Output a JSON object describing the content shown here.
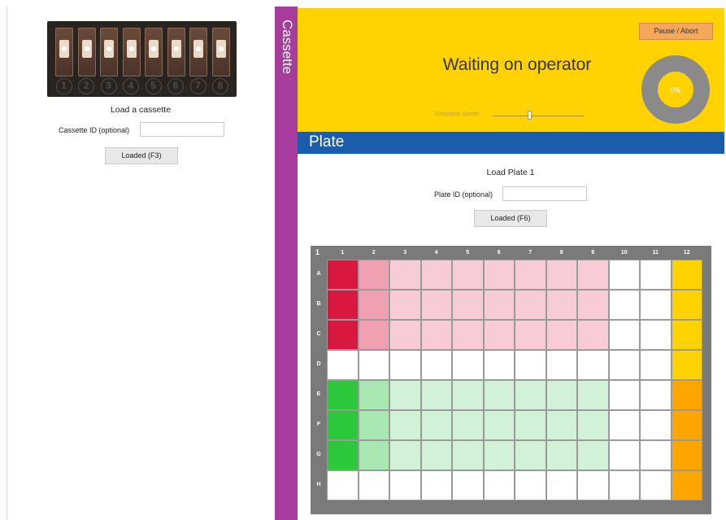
{
  "cassette_panel": {
    "slot_numbers": [
      "1",
      "2",
      "3",
      "4",
      "5",
      "6",
      "7",
      "8"
    ],
    "title": "Load a cassette",
    "cassette_id_label": "Cassette ID (optional)",
    "cassette_id_value": "",
    "loaded_button": "Loaded  (F3)"
  },
  "cassette_strip": {
    "label": "Cassette"
  },
  "status": {
    "message": "Waiting on operator",
    "pause_button": "Pause / Abort",
    "simulation_speed_label": "Simulation Speed",
    "simulation_speed_level": 0.4,
    "progress_percent": 0,
    "progress_text": "0%"
  },
  "plate_panel": {
    "title": "Plate",
    "load_title": "Load Plate 1",
    "plate_id_label": "Plate ID (optional)",
    "plate_id_value": "",
    "loaded_button": "Loaded  (F6)"
  },
  "plate_grid": {
    "corner_label": "1",
    "columns": [
      "1",
      "2",
      "3",
      "4",
      "5",
      "6",
      "7",
      "8",
      "9",
      "10",
      "11",
      "12"
    ],
    "rows": [
      "A",
      "B",
      "C",
      "D",
      "E",
      "F",
      "G",
      "H"
    ],
    "row_colors": [
      [
        "#d9183f",
        "#f0a0b2",
        "#f7ccd6",
        "#f7ccd6",
        "#f7ccd6",
        "#f7ccd6",
        "#f7ccd6",
        "#f7ccd6",
        "#f7ccd6",
        "#ffffff",
        "#ffffff",
        "#ffd200"
      ],
      [
        "#d9183f",
        "#f0a0b2",
        "#f7ccd6",
        "#f7ccd6",
        "#f7ccd6",
        "#f7ccd6",
        "#f7ccd6",
        "#f7ccd6",
        "#f7ccd6",
        "#ffffff",
        "#ffffff",
        "#ffd200"
      ],
      [
        "#d9183f",
        "#f0a0b2",
        "#f7ccd6",
        "#f7ccd6",
        "#f7ccd6",
        "#f7ccd6",
        "#f7ccd6",
        "#f7ccd6",
        "#f7ccd6",
        "#ffffff",
        "#ffffff",
        "#ffd200"
      ],
      [
        "#ffffff",
        "#ffffff",
        "#ffffff",
        "#ffffff",
        "#ffffff",
        "#ffffff",
        "#ffffff",
        "#ffffff",
        "#ffffff",
        "#ffffff",
        "#ffffff",
        "#ffd200"
      ],
      [
        "#2cc83c",
        "#a8e6b2",
        "#d2f2d8",
        "#d2f2d8",
        "#d2f2d8",
        "#d2f2d8",
        "#d2f2d8",
        "#d2f2d8",
        "#d2f2d8",
        "#ffffff",
        "#ffffff",
        "#ffa500"
      ],
      [
        "#2cc83c",
        "#a8e6b2",
        "#d2f2d8",
        "#d2f2d8",
        "#d2f2d8",
        "#d2f2d8",
        "#d2f2d8",
        "#d2f2d8",
        "#d2f2d8",
        "#ffffff",
        "#ffffff",
        "#ffa500"
      ],
      [
        "#2cc83c",
        "#a8e6b2",
        "#d2f2d8",
        "#d2f2d8",
        "#d2f2d8",
        "#d2f2d8",
        "#d2f2d8",
        "#d2f2d8",
        "#d2f2d8",
        "#ffffff",
        "#ffffff",
        "#ffa500"
      ],
      [
        "#ffffff",
        "#ffffff",
        "#ffffff",
        "#ffffff",
        "#ffffff",
        "#ffffff",
        "#ffffff",
        "#ffffff",
        "#ffffff",
        "#ffffff",
        "#ffffff",
        "#ffa500"
      ]
    ]
  },
  "colors": {
    "cassette_strip": "#a63c9c",
    "status_bar": "#ffd200",
    "plate_header": "#1b5cab",
    "pause_button": "#f5a85a",
    "progress_ring": "#8a8a8a",
    "progress_center": "#ffd200"
  },
  "icons": {
    "progress": "progress-ring-icon",
    "slider": "slider-thumb-icon"
  }
}
